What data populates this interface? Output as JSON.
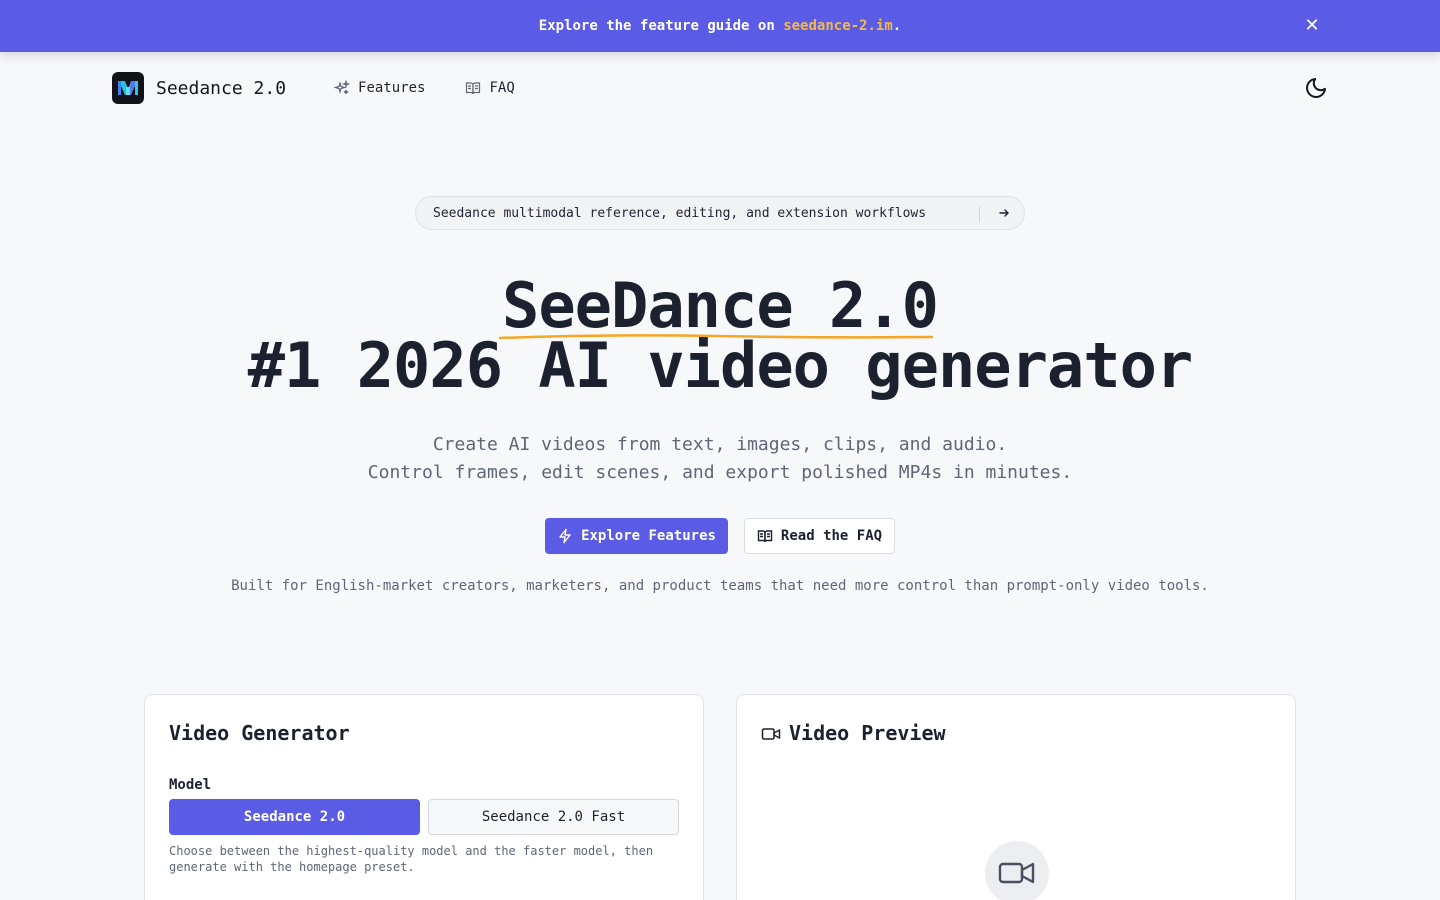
{
  "banner": {
    "text_before": "Explore the feature guide on ",
    "link": "seedance-2.im",
    "text_after": ".",
    "close_icon": "close-icon"
  },
  "nav": {
    "brand": "Seedance 2.0",
    "features": "Features",
    "faq": "FAQ",
    "theme_icon": "moon-icon"
  },
  "announcement": {
    "text": "Seedance multimodal reference, editing, and extension workflows",
    "icon": "arrow-right-icon"
  },
  "hero": {
    "title_line1": "SeeDance 2.0",
    "title_line2": "#1 2026 AI video generator",
    "subtitle_line1": "Create AI videos from text, images, clips, and audio.",
    "subtitle_line2": "Control frames, edit scenes, and export polished MP4s in minutes.",
    "primary_button": "Explore Features",
    "secondary_button": "Read the FAQ",
    "audience": "Built for English-market creators, marketers, and product teams that need more control than prompt-only video tools."
  },
  "generator": {
    "title": "Video Generator",
    "model_label": "Model",
    "models": [
      "Seedance 2.0",
      "Seedance 2.0 Fast"
    ],
    "selected_model": "Seedance 2.0",
    "help": "Choose between the highest-quality model and the faster model, then generate with the homepage preset."
  },
  "preview": {
    "title": "Video Preview",
    "icon": "video-camera-icon"
  },
  "colors": {
    "accent": "#5b5ce6",
    "banner_link": "#f5b84a",
    "underline": "#f5a623"
  }
}
